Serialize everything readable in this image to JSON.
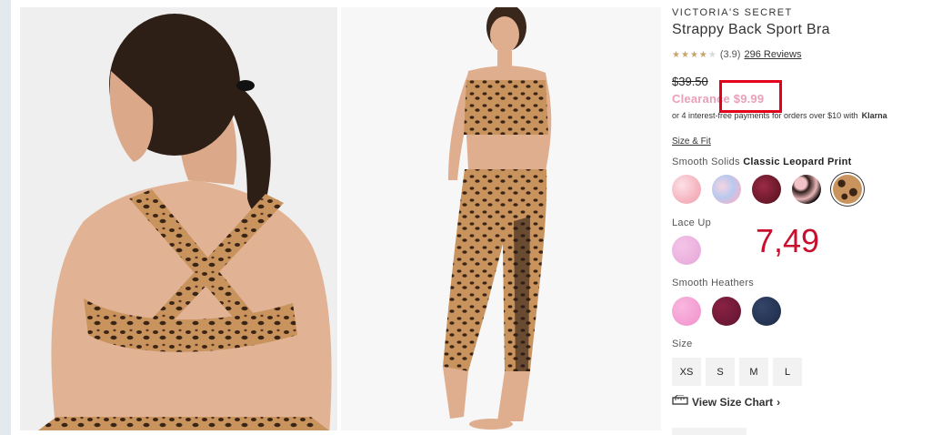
{
  "product": {
    "brand": "VICTORIA'S SECRET",
    "title": "Strappy Back Sport Bra",
    "rating_value": "(3.9)",
    "rating_stars": 3.9,
    "reviews_label": "296 Reviews",
    "original_price": "$39.50",
    "clearance_price": "Clearance $9.99",
    "installments_text": "or 4 interest-free payments for orders over $10 with",
    "installments_brand": "Klarna",
    "size_fit_label": "Size & Fit"
  },
  "colors": {
    "smooth_solids_label": "Smooth Solids",
    "selected_color": "Classic Leopard Print",
    "lace_up_label": "Lace Up",
    "smooth_heathers_label": "Smooth Heathers"
  },
  "annotation": {
    "text": "7,49"
  },
  "sizes": {
    "label": "Size",
    "options": [
      "XS",
      "S",
      "M",
      "L"
    ],
    "size_chart_label": "View Size Chart"
  },
  "icons": [
    "star-icon",
    "ruler-icon",
    "chevron-right-icon"
  ]
}
